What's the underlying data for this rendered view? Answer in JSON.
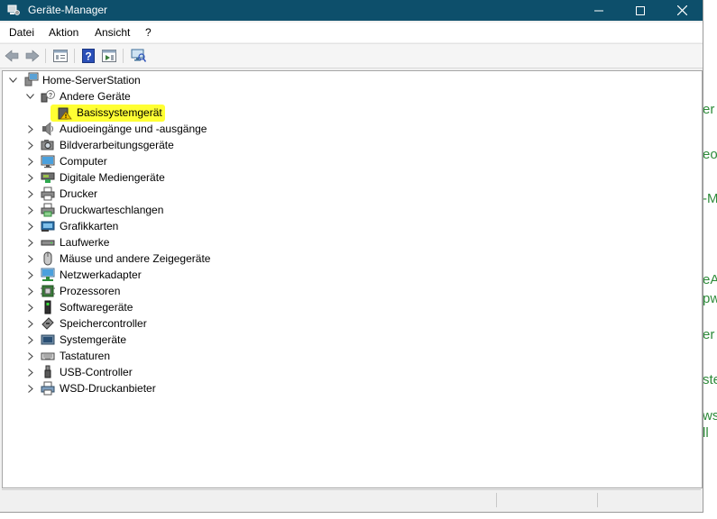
{
  "window": {
    "title": "Geräte-Manager"
  },
  "menu": [
    "Datei",
    "Aktion",
    "Ansicht",
    "?"
  ],
  "tree": {
    "root": "Home-ServerStation",
    "expanded": {
      "label": "Andere Geräte",
      "child": "Basissystemgerät"
    },
    "categories": [
      {
        "label": "Audioeingänge und -ausgänge",
        "icon": "speaker-icon"
      },
      {
        "label": "Bildverarbeitungsgeräte",
        "icon": "camera-icon"
      },
      {
        "label": "Computer",
        "icon": "monitor-icon"
      },
      {
        "label": "Digitale Mediengeräte",
        "icon": "media-device-icon"
      },
      {
        "label": "Drucker",
        "icon": "printer-icon"
      },
      {
        "label": "Druckwarteschlangen",
        "icon": "print-queue-icon"
      },
      {
        "label": "Grafikkarten",
        "icon": "display-adapter-icon"
      },
      {
        "label": "Laufwerke",
        "icon": "drive-icon"
      },
      {
        "label": "Mäuse und andere Zeigegeräte",
        "icon": "mouse-icon"
      },
      {
        "label": "Netzwerkadapter",
        "icon": "network-icon"
      },
      {
        "label": "Prozessoren",
        "icon": "processor-icon"
      },
      {
        "label": "Softwaregeräte",
        "icon": "software-device-icon"
      },
      {
        "label": "Speichercontroller",
        "icon": "storage-controller-icon"
      },
      {
        "label": "Systemgeräte",
        "icon": "system-device-icon"
      },
      {
        "label": "Tastaturen",
        "icon": "keyboard-icon"
      },
      {
        "label": "USB-Controller",
        "icon": "usb-icon"
      },
      {
        "label": "WSD-Druckanbieter",
        "icon": "wsd-printer-icon"
      }
    ]
  },
  "background_fragments": [
    "er",
    "eo",
    "-M",
    "eA",
    "pw",
    "er",
    "ste",
    "ws",
    "ll"
  ],
  "colors": {
    "titlebar": "#0d4f6b",
    "highlight": "#ffff33",
    "background_text": "#2e8b3a"
  }
}
